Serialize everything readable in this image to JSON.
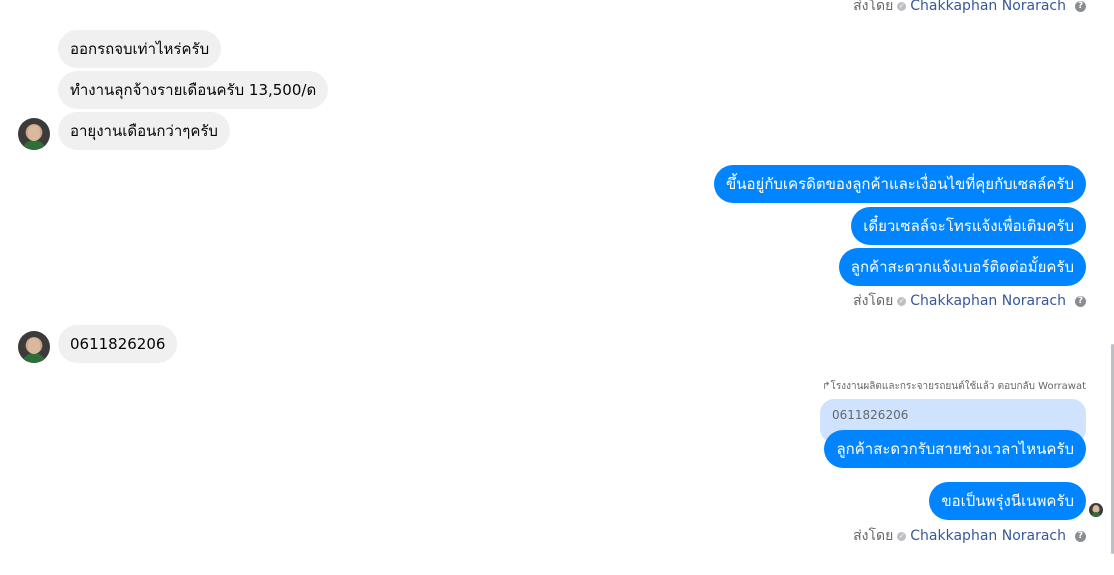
{
  "sent_by": {
    "prefix": "ส่งโดย",
    "name": "Chakkaphan Norarach",
    "help": "?"
  },
  "incoming_1": [
    "ออกรถจบเท่าไหร่ครับ",
    "ทำงานลุกจ้างรายเดือนครับ 13,500/ด",
    "อายุงานเดือนกว่าๆครับ"
  ],
  "outgoing_1": [
    "ขึ้นอยู่กับเครดิตของลูกค้าและเงื่อนไขที่คุยกับเซลล์ครับ",
    "เดี๋ยวเซลล์จะโทรแจ้งเพื่อเติมครับ",
    "ลูกค้าสะดวกแจ้งเบอร์ติดต่อมั้ยครับ"
  ],
  "incoming_2": [
    "0611826206"
  ],
  "reply": {
    "label": "↱โรงงานผลิตและกระจายรถยนต์ใช้แล้ว ตอบกลับ Worrawat",
    "quoted_text": "0611826206",
    "message": "ลูกค้าสะดวกรับสายช่วงเวลาไหนครับ"
  },
  "outgoing_2": [
    "ขอเป็นพรุ่งนีเนพครับ"
  ],
  "colors": {
    "outgoing_bubble": "#0084ff",
    "incoming_bubble": "#f0f0f0",
    "quote_bubble": "#cfe3ff",
    "sender_name": "#385898"
  }
}
